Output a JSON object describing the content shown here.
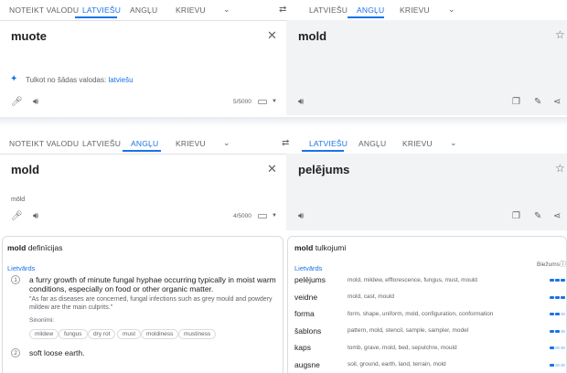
{
  "top": {
    "source_tabs": [
      "NOTEIKT VALODU",
      "LATVIEŠU",
      "ANGĻU",
      "KRIEVU"
    ],
    "target_tabs": [
      "LATVIEŠU",
      "ANGĻU",
      "KRIEVU"
    ],
    "source_input": "muote",
    "target_output": "mold",
    "detect_text": "Tulkot no šādas valodas:",
    "detect_link": "latviešu",
    "char_count": "5/5000"
  },
  "bottom": {
    "source_tabs": [
      "NOTEIKT VALODU",
      "LATVIEŠU",
      "ANGĻU",
      "KRIEVU"
    ],
    "target_tabs": [
      "LATVIEŠU",
      "ANGĻU",
      "KRIEVU"
    ],
    "source_input": "mold",
    "transliteration": "mōld",
    "target_output": "pelējums",
    "char_count": "4/5000"
  },
  "definitions": {
    "title_word": "mold",
    "title_suffix": "definīcijas",
    "pos": "Lietvārds",
    "items": [
      {
        "num": "1",
        "text_line1": "a furry growth of minute fungal hyphae occurring typically in moist warm",
        "text_line2": "conditions, especially on food or other organic matter.",
        "example_line1": "\"As far as diseases are concerned, fungal infections such as grey mould and powdery",
        "example_line2": "mildew are the main culprits.\"",
        "synonyms_label": "Sinonīmi:",
        "synonyms": [
          "mildew",
          "fungus",
          "dry rot",
          "must",
          "moldiness",
          "mustiness"
        ]
      },
      {
        "num": "2",
        "text_line1": "soft loose earth."
      }
    ]
  },
  "translations": {
    "title_word": "mold",
    "title_suffix": "tulkojumi",
    "pos": "Lietvārds",
    "frequency_label": "Biežums",
    "rows": [
      {
        "word": "pelējums",
        "synonyms": "mold, mildew, efflorescence, fungus, must, mould",
        "freq": 3
      },
      {
        "word": "veidne",
        "synonyms": "mold, cast, mould",
        "freq": 3
      },
      {
        "word": "forma",
        "synonyms": "form, shape, uniform, mold, configuration, conformation",
        "freq": 2
      },
      {
        "word": "šablons",
        "synonyms": "pattern, mold, stencil, sample, sampler, model",
        "freq": 2
      },
      {
        "word": "kaps",
        "synonyms": "tomb, grave, mold, bed, sepulchre, mould",
        "freq": 1
      },
      {
        "word": "augsne",
        "synonyms": "soil, ground, earth, land, terrain, mold",
        "freq": 1
      }
    ]
  }
}
